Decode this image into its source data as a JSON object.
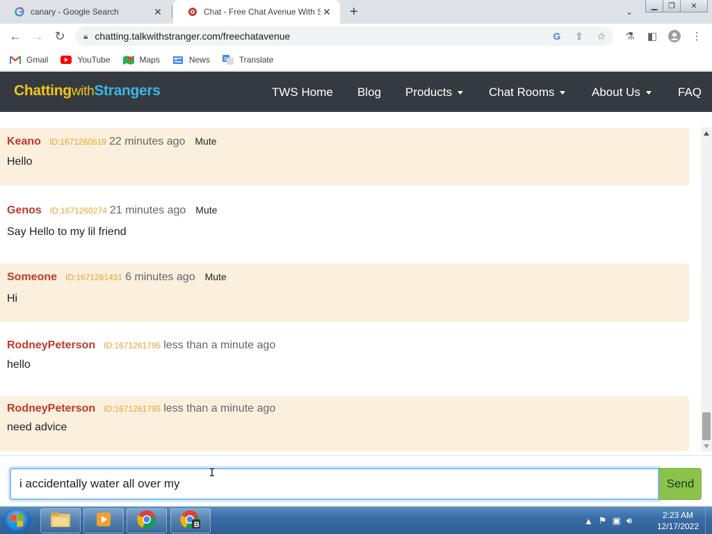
{
  "browser": {
    "tabs": [
      {
        "title": "canary - Google Search",
        "favicon": "google-g-icon",
        "active": false
      },
      {
        "title": "Chat - Free Chat Avenue With Str",
        "favicon": "tws-logo-icon",
        "active": true
      }
    ],
    "url": "chatting.talkwithstranger.com/freechatavenue",
    "bookmarks": [
      {
        "label": "Gmail",
        "icon": "gmail-icon"
      },
      {
        "label": "YouTube",
        "icon": "youtube-icon"
      },
      {
        "label": "Maps",
        "icon": "maps-icon"
      },
      {
        "label": "News",
        "icon": "news-icon"
      },
      {
        "label": "Translate",
        "icon": "translate-icon"
      }
    ]
  },
  "site": {
    "brand": {
      "part1": "Chatting",
      "part2": "with",
      "part3": "Strangers"
    },
    "nav": [
      {
        "label": "TWS Home",
        "dropdown": false
      },
      {
        "label": "Blog",
        "dropdown": false
      },
      {
        "label": "Products",
        "dropdown": true
      },
      {
        "label": "Chat Rooms",
        "dropdown": true
      },
      {
        "label": "About Us",
        "dropdown": true
      },
      {
        "label": "FAQ",
        "dropdown": false
      }
    ]
  },
  "chat": {
    "messages": [
      {
        "user": "Keano",
        "id": "ID:1671260519",
        "time": "22 minutes ago",
        "mute": "Mute",
        "text": "Hello",
        "tinted": true
      },
      {
        "user": "Genos",
        "id": "ID:1671260274",
        "time": "21 minutes ago",
        "mute": "Mute",
        "text": "Say Hello to my lil friend",
        "tinted": false
      },
      {
        "user": "Someone",
        "id": "ID:1671261431",
        "time": "6 minutes ago",
        "mute": "Mute",
        "text": "Hi",
        "tinted": true
      },
      {
        "user": "RodneyPeterson",
        "id": "ID:1671261795",
        "time": "less than a minute ago",
        "mute": "",
        "text": "hello",
        "tinted": false
      },
      {
        "user": "RodneyPeterson",
        "id": "ID:1671261795",
        "time": "less than a minute ago",
        "mute": "",
        "text": "need advice",
        "tinted": true
      }
    ],
    "input_value": "i accidentally water all over my",
    "send_label": "Send"
  },
  "taskbar": {
    "time": "2:23 AM",
    "date": "12/17/2022"
  },
  "colors": {
    "navbar": "#343a40",
    "brand_yellow": "#f5c518",
    "brand_blue": "#3fb5e5",
    "username": "#c0392b",
    "user_id": "#e5a231",
    "message_tint": "#fbf0dd",
    "send_button": "#8bc34a"
  }
}
